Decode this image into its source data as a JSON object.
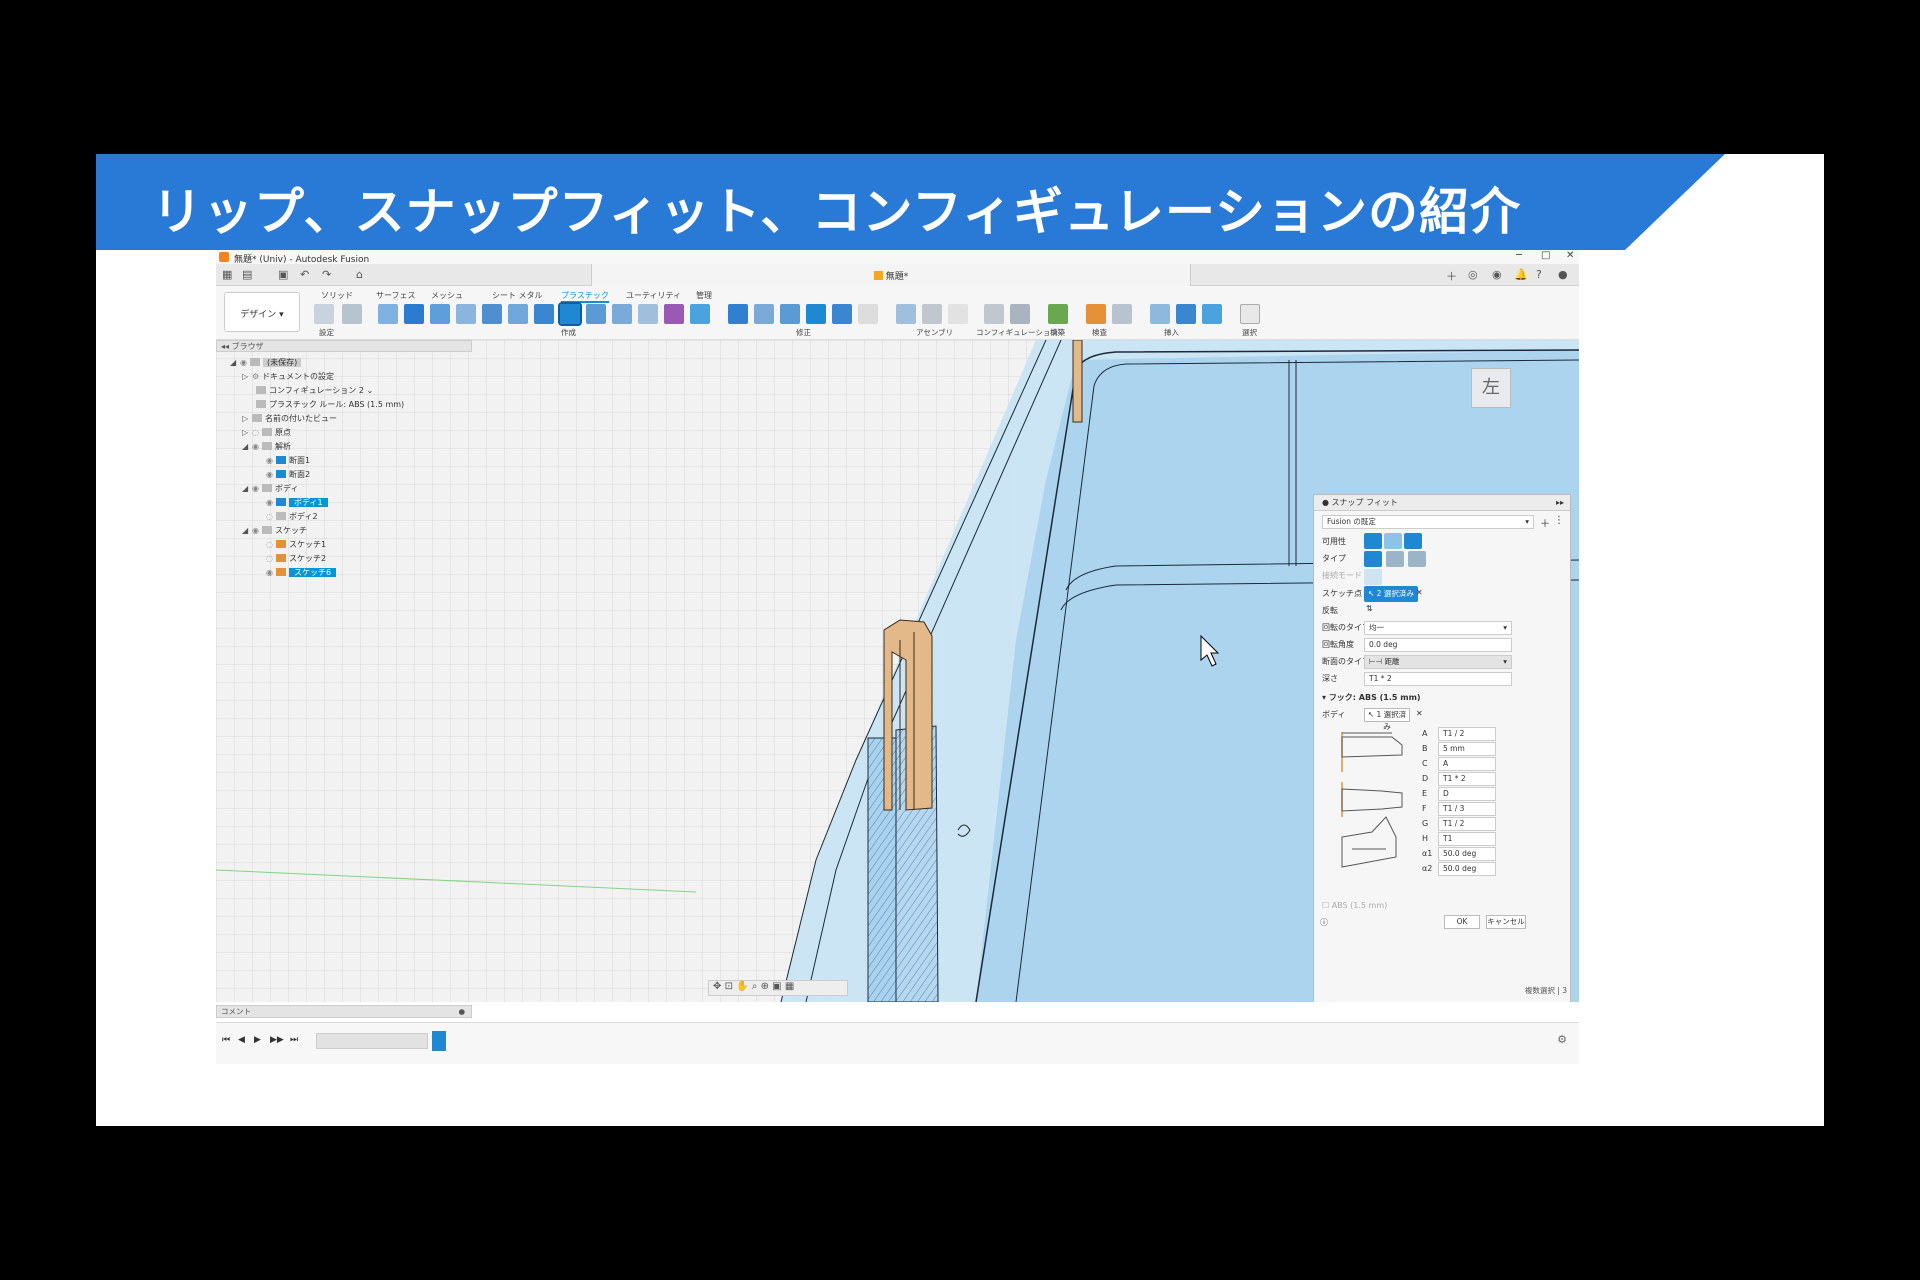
{
  "slide": {
    "title": "リップ、スナップフィット、コンフィギュレーションの紹介",
    "banner_color": "#2979d6"
  },
  "app": {
    "window_title": "無題* (Univ) - Autodesk Fusion",
    "document_tab": "無題*",
    "workspace": "デザイン",
    "ribbon_tabs": [
      "ソリッド",
      "サーフェス",
      "メッシュ",
      "シート メタル",
      "プラスチック",
      "ユーティリティ",
      "管理"
    ],
    "active_tab": "プラスチック",
    "ribbon_groups": [
      "設定",
      "作成",
      "修正",
      "アセンブリ",
      "コンフィギュレーション",
      "構築",
      "検査",
      "挿入",
      "選択"
    ],
    "accent": "#0696d7"
  },
  "browser": {
    "header": "ブラウザ",
    "root": "(未保存)",
    "items": [
      {
        "label": "ドキュメントの設定"
      },
      {
        "label": "コンフィギュレーション 2"
      },
      {
        "label": "プラスチック ルール: ABS (1.5 mm)"
      },
      {
        "label": "名前の付いたビュー"
      },
      {
        "label": "原点"
      },
      {
        "label": "解析"
      },
      {
        "label": "断面1"
      },
      {
        "label": "断面2"
      },
      {
        "label": "ボディ"
      },
      {
        "label": "ボディ1"
      },
      {
        "label": "ボディ2"
      },
      {
        "label": "スケッチ"
      },
      {
        "label": "スケッチ1"
      },
      {
        "label": "スケッチ2"
      },
      {
        "label": "スケッチ6"
      }
    ]
  },
  "comment_bar": {
    "label": "コメント"
  },
  "viewcube": {
    "face": "左"
  },
  "dialog": {
    "title": "スナップ フィット",
    "preset": "Fusion の既定",
    "labels": {
      "variability": "可用性",
      "type": "タイプ",
      "mode": "接続モード",
      "sketch_point": "スケッチ点",
      "flip": "反転",
      "rotation_type": "回転のタイプ",
      "rotation_angle": "回転角度",
      "section_type": "断面のタイプ",
      "depth": "深さ",
      "hook_section": "フック: ABS (1.5 mm)",
      "body": "ボディ"
    },
    "sketch_point_value": "2 選択済み",
    "rotation_type_value": "均一",
    "rotation_angle_value": "0.0 deg",
    "section_type_value": "距離",
    "depth_value": "T1 * 2",
    "body_value": "1 選択済み",
    "params": [
      {
        "name": "A",
        "value": "T1 / 2"
      },
      {
        "name": "B",
        "value": "5 mm"
      },
      {
        "name": "C",
        "value": "A"
      },
      {
        "name": "D",
        "value": "T1 * 2"
      },
      {
        "name": "E",
        "value": "D"
      },
      {
        "name": "F",
        "value": "T1 / 3"
      },
      {
        "name": "G",
        "value": "T1 / 2"
      },
      {
        "name": "H",
        "value": "T1"
      },
      {
        "name": "α1",
        "value": "50.0 deg"
      },
      {
        "name": "α2",
        "value": "50.0 deg"
      }
    ],
    "footer_rule": "ABS (1.5 mm)",
    "ok": "OK",
    "cancel": "キャンセル"
  },
  "status": {
    "text": "複数選択 | 3"
  }
}
